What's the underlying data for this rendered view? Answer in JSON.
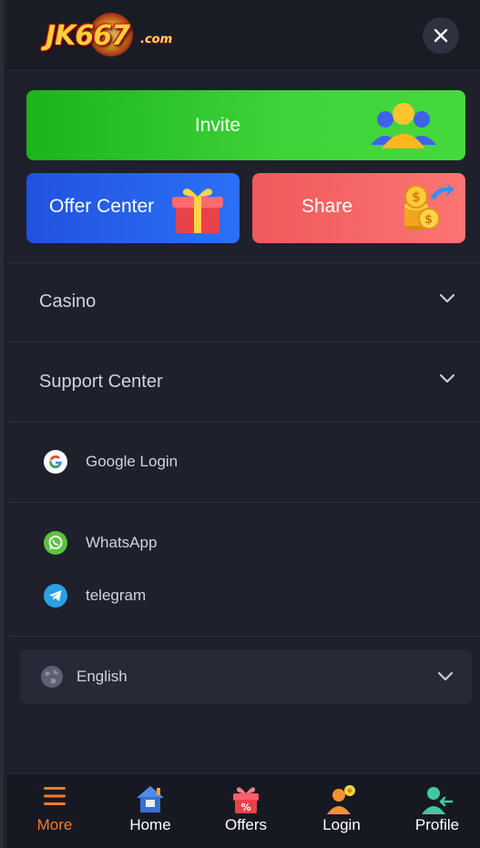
{
  "header": {
    "logo_text": "JK667",
    "logo_suffix": ".com",
    "close_icon": "close-icon"
  },
  "promos": {
    "invite_label": "Invite",
    "offer_label": "Offer Center",
    "share_label": "Share"
  },
  "menu": {
    "casino_label": "Casino",
    "support_label": "Support Center",
    "google_label": "Google Login",
    "whatsapp_label": "WhatsApp",
    "telegram_label": "telegram"
  },
  "language": {
    "selected": "English"
  },
  "bottom_nav": {
    "items": [
      {
        "label": "More",
        "icon": "menu-icon",
        "active": true
      },
      {
        "label": "Home",
        "icon": "home-icon",
        "active": false
      },
      {
        "label": "Offers",
        "icon": "gift-icon",
        "active": false
      },
      {
        "label": "Login",
        "icon": "login-icon",
        "active": false
      },
      {
        "label": "Profile",
        "icon": "profile-icon",
        "active": false
      }
    ]
  },
  "colors": {
    "background": "#1e202b",
    "invite_green": "#2fc42b",
    "offer_blue": "#2563ec",
    "share_red": "#f56866",
    "active_orange": "#f47b2a"
  }
}
